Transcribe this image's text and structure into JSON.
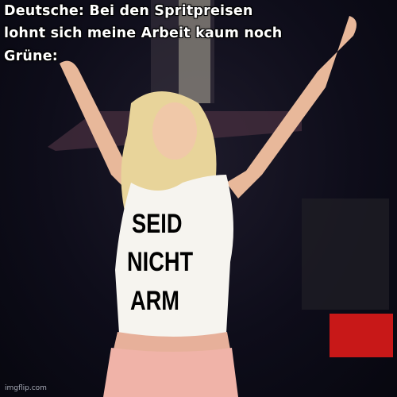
{
  "caption": {
    "line1": "Deutsche: Bei den Spritpreisen",
    "line2": "lohnt sich meine Arbeit kaum noch",
    "line3": "Grüne:"
  },
  "shirt_text": {
    "line1": "SEID",
    "line2": "NICHT",
    "line3": "ARM"
  },
  "watermark": "imgflip.com"
}
